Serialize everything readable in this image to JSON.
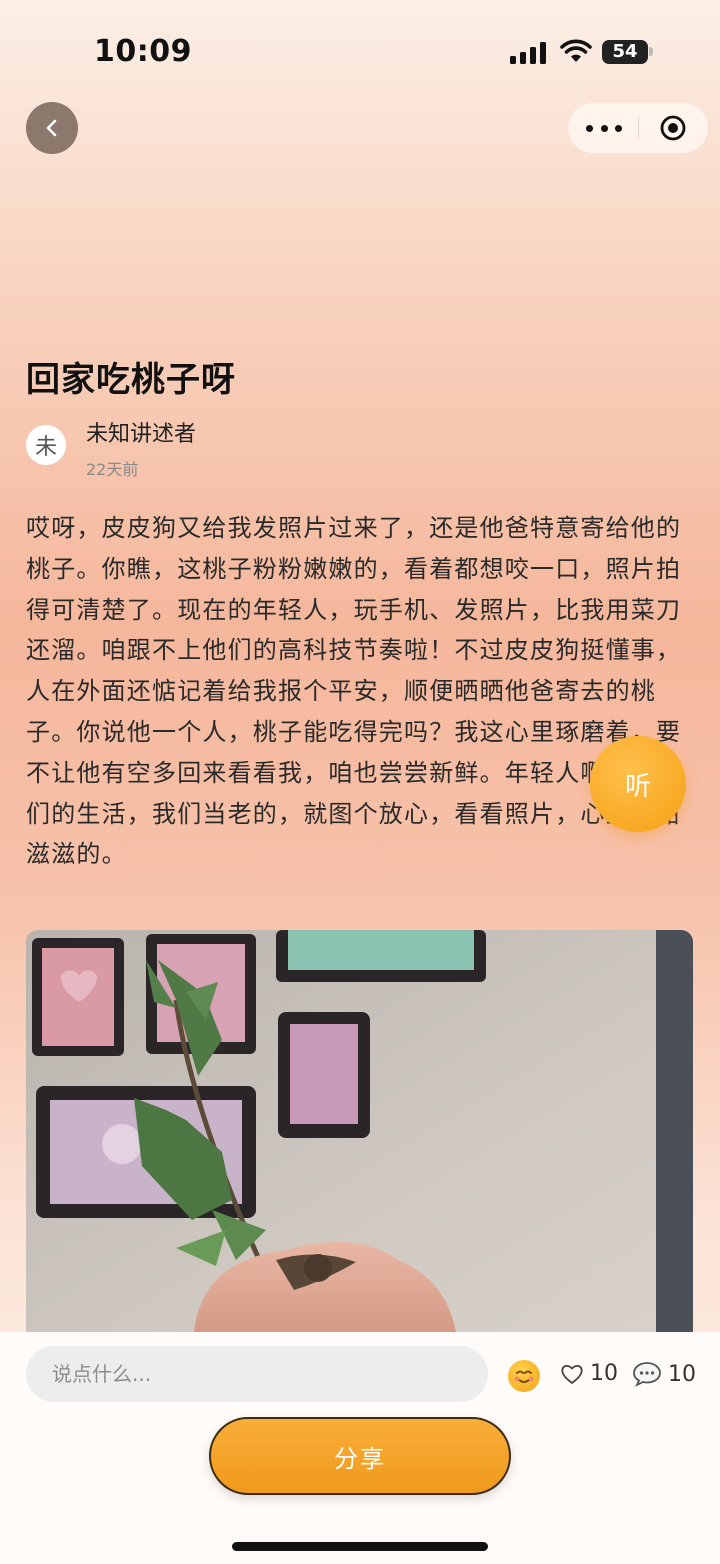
{
  "status_bar": {
    "time": "10:09",
    "battery": "54",
    "icons": [
      "signal-icon",
      "wifi-icon",
      "battery-icon"
    ]
  },
  "nav": {
    "back_icon": "chevron-left-icon",
    "more_icon": "more-dots-icon",
    "close_icon": "target-circle-icon"
  },
  "article": {
    "title": "回家吃桃子呀",
    "author": {
      "avatar_text": "未",
      "name": "未知讲述者",
      "time": "22天前"
    },
    "body": "哎呀，皮皮狗又给我发照片过来了，还是他爸特意寄给他的桃子。你瞧，这桃子粉粉嫩嫩的，看着都想咬一口，照片拍得可清楚了。现在的年轻人，玩手机、发照片，比我用菜刀还溜。咱跟不上他们的高科技节奏啦！不过皮皮狗挺懂事，人在外面还惦记着给我报个平安，顺便晒晒他爸寄去的桃子。你说他一个人，桃子能吃得完吗？我这心里琢磨着，要不让他有空多回来看看我，咱也尝尝新鲜。年轻人啊，有他们的生活，我们当老的，就图个放心，看看照片，心里也甜滋滋的。",
    "listen_label": "听",
    "photo_alt": "hand holding a peach branch with green leaves in front of framed pictures on a wall"
  },
  "bottom_bar": {
    "comment_placeholder": "说点什么...",
    "emoji_icon": "smile-emoji-icon",
    "like_count": "10",
    "comment_count": "10",
    "share_label": "分享"
  },
  "colors": {
    "accent": "#f5a012",
    "share_button": "#f5a629",
    "background_top": "#fbefe6",
    "background_mid": "#f5b79c"
  }
}
